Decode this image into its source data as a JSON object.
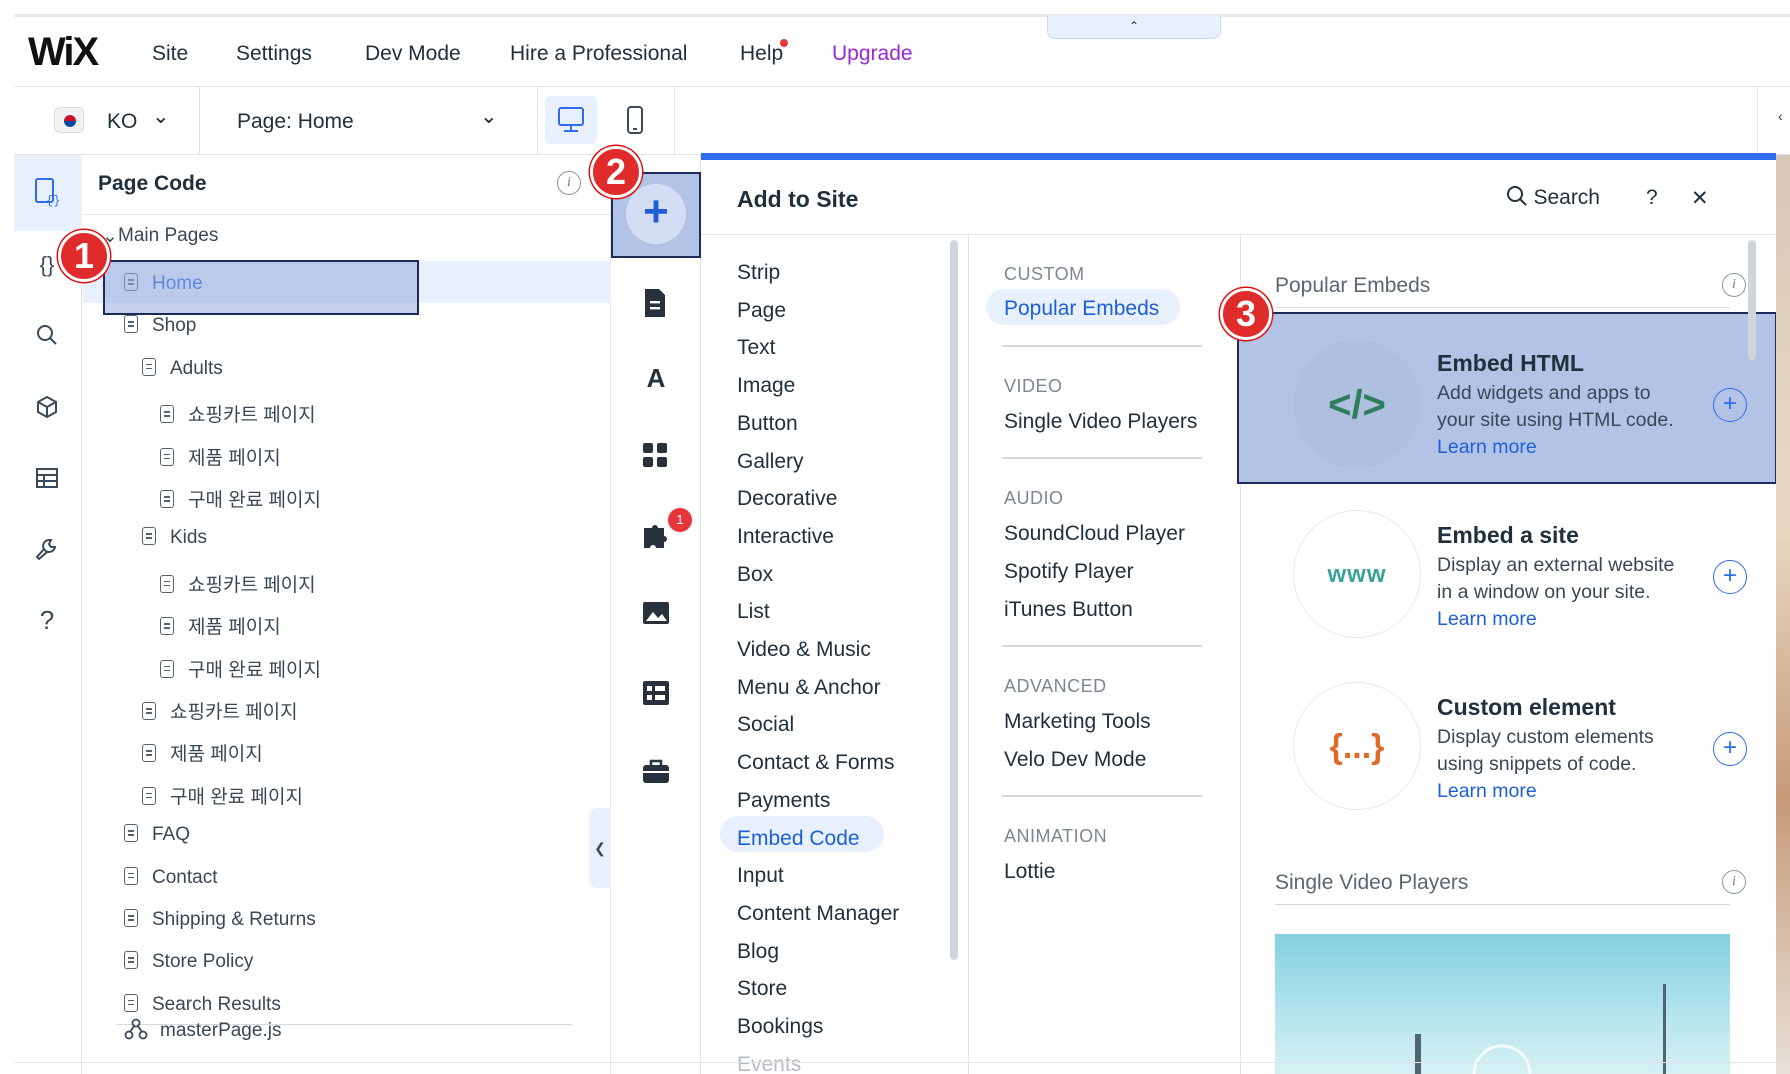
{
  "topbar": {
    "logo": "WiX",
    "menu": [
      "Site",
      "Settings",
      "Dev Mode",
      "Hire a Professional",
      "Help",
      "Upgrade"
    ],
    "collapse_arrow": "⌃"
  },
  "toolbar": {
    "language": "KO",
    "page_selector": "Page: Home",
    "chevron": "⌄"
  },
  "page_code": {
    "title": "Page Code",
    "section": "Main Pages",
    "items": [
      {
        "label": "Home",
        "level": 1
      },
      {
        "label": "Shop",
        "level": 1
      },
      {
        "label": "Adults",
        "level": 2
      },
      {
        "label": "쇼핑카트 페이지",
        "level": 3
      },
      {
        "label": "제품 페이지",
        "level": 3
      },
      {
        "label": "구매 완료 페이지",
        "level": 3
      },
      {
        "label": "Kids",
        "level": 2
      },
      {
        "label": "쇼핑카트 페이지",
        "level": 3
      },
      {
        "label": "제품 페이지",
        "level": 3
      },
      {
        "label": "구매 완료 페이지",
        "level": 3
      },
      {
        "label": "쇼핑카트 페이지",
        "level": 2
      },
      {
        "label": "제품 페이지",
        "level": 2
      },
      {
        "label": "구매 완료 페이지",
        "level": 2
      },
      {
        "label": "FAQ",
        "level": 1
      },
      {
        "label": "Contact",
        "level": 1
      },
      {
        "label": "Shipping & Returns",
        "level": 1
      },
      {
        "label": "Store Policy",
        "level": 1
      },
      {
        "label": "Search Results",
        "level": 1
      }
    ],
    "master": "masterPage.js"
  },
  "add_strip": {
    "notification_count": "1"
  },
  "add_panel": {
    "title": "Add to Site",
    "search": "Search",
    "help": "?",
    "close": "✕",
    "categories": [
      "Strip",
      "Page",
      "Text",
      "Image",
      "Button",
      "Gallery",
      "Decorative",
      "Interactive",
      "Box",
      "List",
      "Video & Music",
      "Menu & Anchor",
      "Social",
      "Contact & Forms",
      "Payments",
      "Embed Code",
      "Input",
      "Content Manager",
      "Blog",
      "Store",
      "Bookings",
      "Events"
    ],
    "selected_category": "Embed Code",
    "subgroups": [
      {
        "heading": "CUSTOM",
        "items": [
          "Popular Embeds"
        ]
      },
      {
        "heading": "VIDEO",
        "items": [
          "Single Video Players"
        ]
      },
      {
        "heading": "AUDIO",
        "items": [
          "SoundCloud Player",
          "Spotify Player",
          "iTunes Button"
        ]
      },
      {
        "heading": "ADVANCED",
        "items": [
          "Marketing Tools",
          "Velo Dev Mode"
        ]
      },
      {
        "heading": "ANIMATION",
        "items": [
          "Lottie"
        ]
      }
    ],
    "section_popular": "Popular Embeds",
    "section_video": "Single Video Players",
    "cards": [
      {
        "title": "Embed HTML",
        "desc": "Add widgets and apps to your site using HTML code.",
        "link": "Learn more",
        "glyph": "</>"
      },
      {
        "title": "Embed a site",
        "desc": "Display an external website in a window on your site.",
        "link": "Learn more",
        "glyph": "www"
      },
      {
        "title": "Custom element",
        "desc": "Display custom elements using snippets of code.",
        "link": "Learn more",
        "glyph": "{...}"
      }
    ]
  },
  "annotations": [
    "1",
    "2",
    "3"
  ],
  "colors": {
    "accent": "#2f6bea",
    "highlight": "#b3c3e6",
    "upgrade": "#9a27d5",
    "badge": "#e02b2b"
  }
}
